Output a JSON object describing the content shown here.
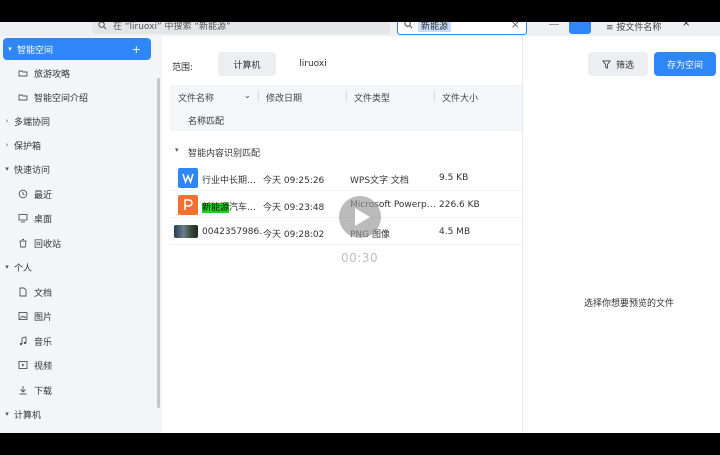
{
  "header": {
    "address": "在 “liruoxi” 中搜索 “新能源”",
    "search_value": "新能源",
    "clear_glyph": "×",
    "sort_label": "按文件名称"
  },
  "sidebar": {
    "items": [
      {
        "label": "智能空间",
        "kind": "group-active",
        "chev": "▾",
        "plus": "+"
      },
      {
        "label": "旅游攻略",
        "kind": "child",
        "icon": "folder-icon"
      },
      {
        "label": "智能空间介绍",
        "kind": "child",
        "icon": "folder-icon"
      },
      {
        "label": "多端协同",
        "kind": "group",
        "chev": "›"
      },
      {
        "label": "保护箱",
        "kind": "group",
        "chev": "›"
      },
      {
        "label": "快速访问",
        "kind": "group",
        "chev": "▾"
      },
      {
        "label": "最近",
        "kind": "child",
        "icon": "clock-icon"
      },
      {
        "label": "桌面",
        "kind": "child",
        "icon": "monitor-icon"
      },
      {
        "label": "回收站",
        "kind": "child",
        "icon": "trash-icon"
      },
      {
        "label": "个人",
        "kind": "group",
        "chev": "▾"
      },
      {
        "label": "文档",
        "kind": "child",
        "icon": "document-icon"
      },
      {
        "label": "图片",
        "kind": "child",
        "icon": "image-icon"
      },
      {
        "label": "音乐",
        "kind": "child",
        "icon": "music-icon"
      },
      {
        "label": "视频",
        "kind": "child",
        "icon": "video-icon"
      },
      {
        "label": "下载",
        "kind": "child",
        "icon": "download-icon"
      },
      {
        "label": "计算机",
        "kind": "group",
        "chev": "▾"
      }
    ]
  },
  "scope": {
    "label": "范围:",
    "tabs": [
      "计算机",
      "liruoxi"
    ],
    "active": 0
  },
  "toolbar": {
    "filter_label": "筛选",
    "save_label": "存为空间"
  },
  "columns": {
    "name": "文件名称",
    "modified": "修改日期",
    "type": "文件类型",
    "size": "文件大小"
  },
  "groups": {
    "name_match": "名称匹配",
    "content_match": "智能内容识别匹配"
  },
  "files": [
    {
      "name": "行业中长期…",
      "date": "今天 09:25:26",
      "type": "WPS文字 文档",
      "size": "9.5 KB",
      "icon": "wps-icon"
    },
    {
      "name_hl": "新能源",
      "name_rest": "汽车…",
      "date": "今天 09:23:48",
      "type": "Microsoft Powerp…",
      "size": "226.6 KB",
      "icon": "ppt-icon"
    },
    {
      "name": "0042357986…",
      "date": "今天 09:28:02",
      "type": "PNG 图像",
      "size": "4.5 MB",
      "icon": "png-thumbnail"
    }
  ],
  "preview": {
    "empty_text": "选择你想要预览的文件"
  },
  "video": {
    "time": "00:30"
  }
}
